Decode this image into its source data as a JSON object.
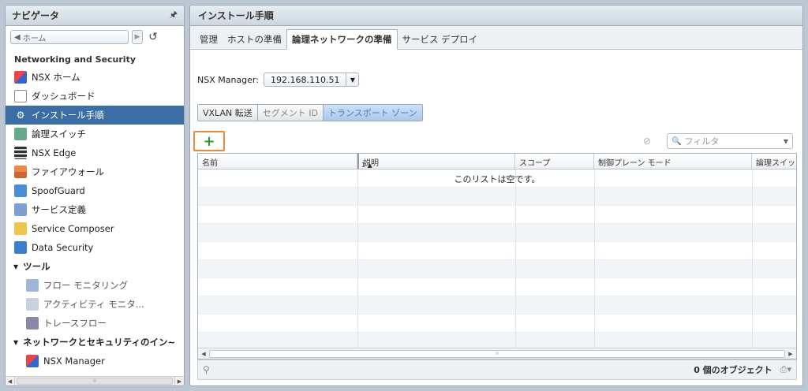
{
  "navigator": {
    "title": "ナビゲータ",
    "pin": "🖈",
    "home_label": "ホーム",
    "section_title": "Networking and Security",
    "items": [
      {
        "label": "NSX ホーム"
      },
      {
        "label": "ダッシュボード"
      },
      {
        "label": "インストール手順"
      },
      {
        "label": "論理スイッチ"
      },
      {
        "label": "NSX Edge"
      },
      {
        "label": "ファイアウォール"
      },
      {
        "label": "SpoofGuard"
      },
      {
        "label": "サービス定義"
      },
      {
        "label": "Service Composer"
      },
      {
        "label": "Data Security"
      }
    ],
    "tools_group": "ツール",
    "tools": [
      {
        "label": "フロー モニタリング"
      },
      {
        "label": "アクティビティ モニタ..."
      },
      {
        "label": "トレースフロー"
      }
    ],
    "network_group": "ネットワークとセキュリティのイン~",
    "network_items": [
      {
        "label": "NSX Manager"
      }
    ]
  },
  "main": {
    "title": "インストール手順",
    "tabs": [
      {
        "label": "管理"
      },
      {
        "label": "ホストの準備"
      },
      {
        "label": "論理ネットワークの準備"
      },
      {
        "label": "サービス デプロイ"
      }
    ],
    "manager_label": "NSX Manager:",
    "manager_value": "192.168.110.51",
    "subtabs": [
      {
        "label": "VXLAN 転送"
      },
      {
        "label": "セグメント ID"
      },
      {
        "label": "トランスポート ゾーン"
      }
    ],
    "add_symbol": "+",
    "filter_placeholder": "フィルタ",
    "columns": [
      {
        "label": "名前"
      },
      {
        "label": "説明"
      },
      {
        "label": "スコープ"
      },
      {
        "label": "制御プレーン モード"
      },
      {
        "label": "論理スイッチ"
      }
    ],
    "sort_indicator": "1 ▲",
    "empty_message": "このリストは空です。",
    "object_count": "0 個のオブジェクト"
  },
  "colors": {
    "selected_nav": "#3a6ea5",
    "add_border": "#f08a3a",
    "add_plus": "#2f9a2f",
    "active_subtab": "#a9c8f0"
  }
}
